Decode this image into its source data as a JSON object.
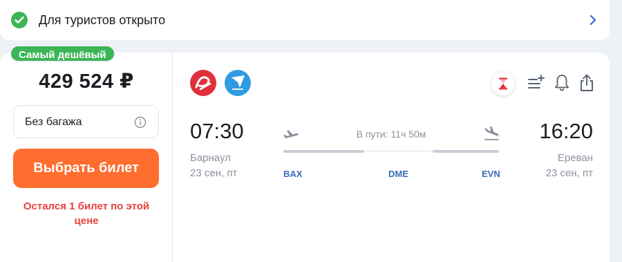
{
  "notice": {
    "text": "Для туристов открыто",
    "icons": {
      "status": "check-circle-icon",
      "arrow": "chevron-right-icon"
    }
  },
  "offer": {
    "badge": "Самый дешёвый",
    "price": "429 524 ₽",
    "baggage_label": "Без багажа",
    "buy_label": "Выбрать билет",
    "warning": "Остался 1 билет по этой цене"
  },
  "flight": {
    "departure": {
      "time": "07:30",
      "city": "Барнаул",
      "date": "23 сен, пт"
    },
    "arrival": {
      "time": "16:20",
      "city": "Ереван",
      "date": "23 сен, пт"
    },
    "duration": "В пути: 11ч 50м",
    "airports": [
      "BAX",
      "DME",
      "EVN"
    ],
    "airline_logos": [
      "red-airline-logo",
      "blue-airline-logo"
    ],
    "actions": [
      "hourglass-icon",
      "add-to-list-icon",
      "bell-icon",
      "share-icon"
    ]
  },
  "colors": {
    "accent_green": "#3cb556",
    "buy_orange": "#ff6d2f",
    "warning_red": "#e5413b",
    "airport_blue": "#3a6bb8"
  }
}
